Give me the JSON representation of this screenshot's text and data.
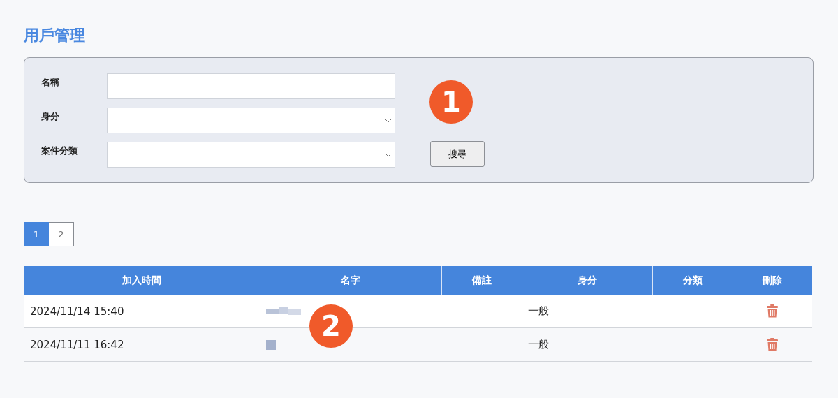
{
  "page": {
    "title": "用戶管理"
  },
  "filter": {
    "fields": [
      {
        "label": "名稱",
        "kind": "text"
      },
      {
        "label": "身分",
        "kind": "select"
      },
      {
        "label": "案件分類",
        "kind": "select"
      }
    ],
    "search_button": "搜尋"
  },
  "pagination": [
    {
      "label": "1",
      "selected": true
    },
    {
      "label": "2",
      "selected": false
    }
  ],
  "table": {
    "columns": [
      "加入時間",
      "名字",
      "備註",
      "身分",
      "分類",
      "刪除"
    ],
    "rows": [
      {
        "joined": "2024/11/14 15:40",
        "name": {
          "kind": "redacted"
        },
        "role": "一般"
      },
      {
        "joined": "2024/11/11 16:42",
        "name": {
          "kind": "redacted"
        },
        "role": "一般"
      }
    ]
  },
  "annotations": [
    {
      "label": "1"
    },
    {
      "label": "2"
    }
  ]
}
